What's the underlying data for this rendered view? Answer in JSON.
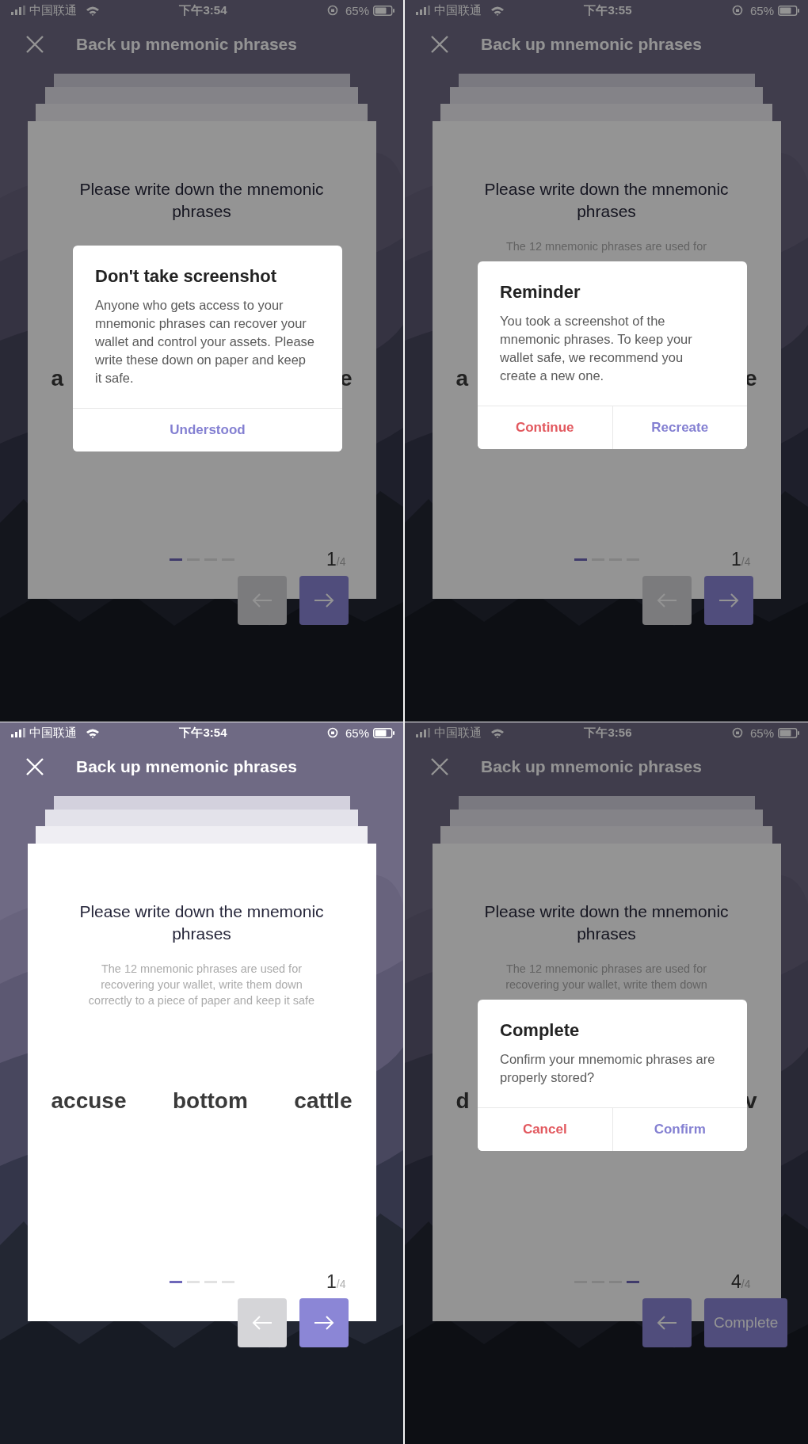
{
  "screens": [
    {
      "status": {
        "carrier": "中国联通",
        "time": "下午3:54",
        "battery": "65%"
      },
      "title": "Back up mnemonic phrases",
      "card": {
        "heading": "Please write down the mnemonic phrases",
        "words": [
          "a",
          "e"
        ],
        "dots": [
          {
            "selected": true
          },
          {
            "selected": false
          },
          {
            "selected": false
          },
          {
            "selected": false
          }
        ],
        "page_current": "1",
        "page_total": "/4"
      },
      "nav": [
        {
          "kind": "back",
          "disabled": true
        },
        {
          "kind": "forward",
          "disabled": false
        }
      ],
      "dialog": {
        "title": "Don't take screenshot",
        "body": "Anyone who gets access to your mnemonic phrases can recover your wallet and control your assets. Please write these down on paper and keep it safe.",
        "buttons": [
          {
            "label": "Understood",
            "kind": "primary"
          }
        ]
      }
    },
    {
      "status": {
        "carrier": "中国联通",
        "time": "下午3:55",
        "battery": "65%"
      },
      "title": "Back up mnemonic phrases",
      "card": {
        "heading": "Please write down the mnemonic phrases",
        "subtitle_lines": [
          "The 12 mnemonic phrases are used for"
        ],
        "words": [
          "a",
          "e"
        ],
        "dots": [
          {
            "selected": true
          },
          {
            "selected": false
          },
          {
            "selected": false
          },
          {
            "selected": false
          }
        ],
        "page_current": "1",
        "page_total": "/4"
      },
      "nav": [
        {
          "kind": "back",
          "disabled": true
        },
        {
          "kind": "forward",
          "disabled": false
        }
      ],
      "dialog": {
        "title": "Reminder",
        "body": "You took a screenshot of the mnemonic phrases. To keep your wallet safe, we recommend you create a new one.",
        "buttons": [
          {
            "label": "Continue",
            "kind": "danger"
          },
          {
            "label": "Recreate",
            "kind": "primary"
          }
        ]
      }
    },
    {
      "status": {
        "carrier": "中国联通",
        "time": "下午3:54",
        "battery": "65%"
      },
      "title": "Back up mnemonic phrases",
      "card": {
        "heading": "Please write down the mnemonic phrases",
        "subtitle_lines": [
          "The 12 mnemonic phrases are used for",
          "recovering your wallet, write them down",
          "correctly to a piece of paper and keep it safe"
        ],
        "words": [
          "accuse",
          "bottom",
          "cattle"
        ],
        "dots": [
          {
            "selected": true
          },
          {
            "selected": false
          },
          {
            "selected": false
          },
          {
            "selected": false
          }
        ],
        "page_current": "1",
        "page_total": "/4"
      },
      "nav": [
        {
          "kind": "back",
          "disabled": true
        },
        {
          "kind": "forward",
          "disabled": false
        }
      ]
    },
    {
      "status": {
        "carrier": "中国联通",
        "time": "下午3:56",
        "battery": "65%"
      },
      "title": "Back up mnemonic phrases",
      "card": {
        "heading": "Please write down the mnemonic phrases",
        "subtitle_lines": [
          "The 12 mnemonic phrases are used for",
          "recovering your wallet, write them down"
        ],
        "words": [
          "d",
          "v"
        ],
        "dots": [
          {
            "selected": false
          },
          {
            "selected": false
          },
          {
            "selected": false
          },
          {
            "selected": true
          }
        ],
        "page_current": "4",
        "page_total": "/4"
      },
      "nav": [
        {
          "kind": "back",
          "disabled": false
        },
        {
          "kind": "text",
          "label": "Complete"
        }
      ],
      "dialog": {
        "title": "Complete",
        "body": "Confirm your mnemomic phrases are properly stored?",
        "buttons": [
          {
            "label": "Cancel",
            "kind": "danger"
          },
          {
            "label": "Confirm",
            "kind": "primary"
          }
        ]
      }
    }
  ]
}
